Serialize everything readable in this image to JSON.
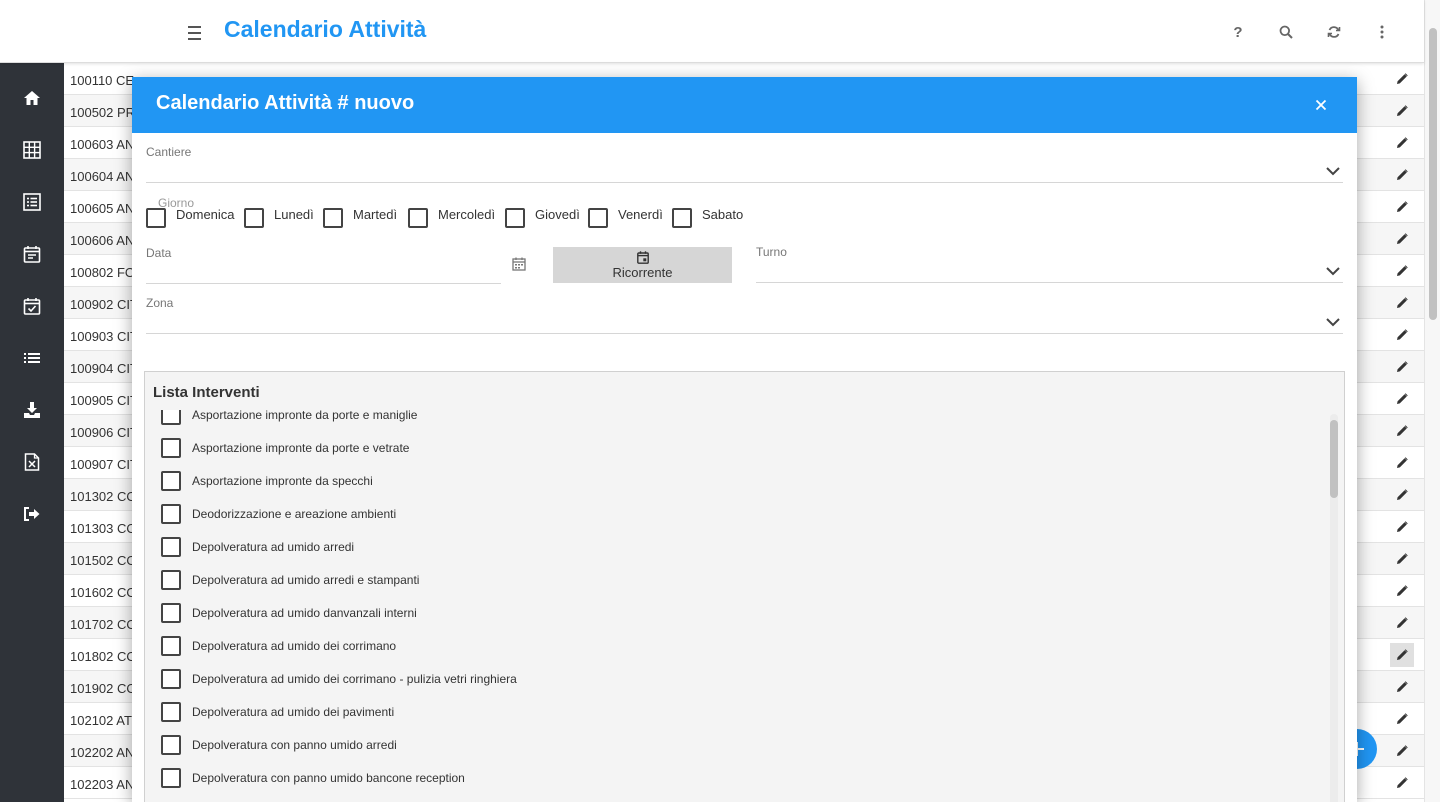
{
  "header": {
    "title": "Calendario Attività"
  },
  "toolbar": {
    "help_label": "?"
  },
  "background_rows": [
    {
      "code": "100110 CE",
      "active": false
    },
    {
      "code": "100502 PR",
      "active": false
    },
    {
      "code": "100603 AN",
      "active": false
    },
    {
      "code": "100604 AN",
      "active": false
    },
    {
      "code": "100605 AN",
      "active": false
    },
    {
      "code": "100606 AN",
      "active": false
    },
    {
      "code": "100802 FO",
      "active": false
    },
    {
      "code": "100902 CIT",
      "active": false
    },
    {
      "code": "100903 CIT",
      "active": false
    },
    {
      "code": "100904 CIT",
      "active": false
    },
    {
      "code": "100905 CIT",
      "active": false
    },
    {
      "code": "100906 CIT",
      "active": false
    },
    {
      "code": "100907 CIT",
      "active": false
    },
    {
      "code": "101302 CO",
      "active": false
    },
    {
      "code": "101303 CO",
      "active": false
    },
    {
      "code": "101502 CO",
      "active": false
    },
    {
      "code": "101602 CO",
      "active": false
    },
    {
      "code": "101702 CO",
      "active": false
    },
    {
      "code": "101802 CO",
      "active": true
    },
    {
      "code": "101902 CO",
      "active": false
    },
    {
      "code": "102102 AT",
      "active": false
    },
    {
      "code": "102202 AN",
      "active": false
    },
    {
      "code": "102203 AN",
      "active": false
    }
  ],
  "modal": {
    "title": "Calendario Attività # nuovo",
    "cantiere_label": "Cantiere",
    "giorno_label": "Giorno",
    "days": [
      "Domenica",
      "Lunedì",
      "Martedì",
      "Mercoledì",
      "Giovedì",
      "Venerdì",
      "Sabato"
    ],
    "data_label": "Data",
    "data_value": "",
    "ricorrente_label": "Ricorrente",
    "turno_label": "Turno",
    "zona_label": "Zona",
    "lista_title": "Lista Interventi",
    "interventi": [
      "Asportazione impronte da porte e maniglie",
      "Asportazione impronte da porte e vetrate",
      "Asportazione impronte da specchi",
      "Deodorizzazione e areazione ambienti",
      "Depolveratura ad umido arredi",
      "Depolveratura ad umido arredi e stampanti",
      "Depolveratura ad umido danvanzali interni",
      "Depolveratura ad umido dei corrimano",
      "Depolveratura ad umido dei corrimano - pulizia vetri ringhiera",
      "Depolveratura ad umido dei pavimenti",
      "Depolveratura con panno umido arredi",
      "Depolveratura con panno umido bancone reception"
    ]
  },
  "colors": {
    "primary": "#2196f3",
    "sidebar": "#2f3339",
    "button_gray": "#d6d6d6"
  },
  "icons": {
    "toolbar": [
      "menu-icon",
      "help-icon",
      "search-icon",
      "refresh-icon",
      "more-vert-icon"
    ],
    "sidebar": [
      "home-icon",
      "grid-icon",
      "list-alt-icon",
      "calendar-icon",
      "calendar-check-icon",
      "list-icon",
      "download-icon",
      "excel-icon",
      "sign-out-icon"
    ]
  }
}
